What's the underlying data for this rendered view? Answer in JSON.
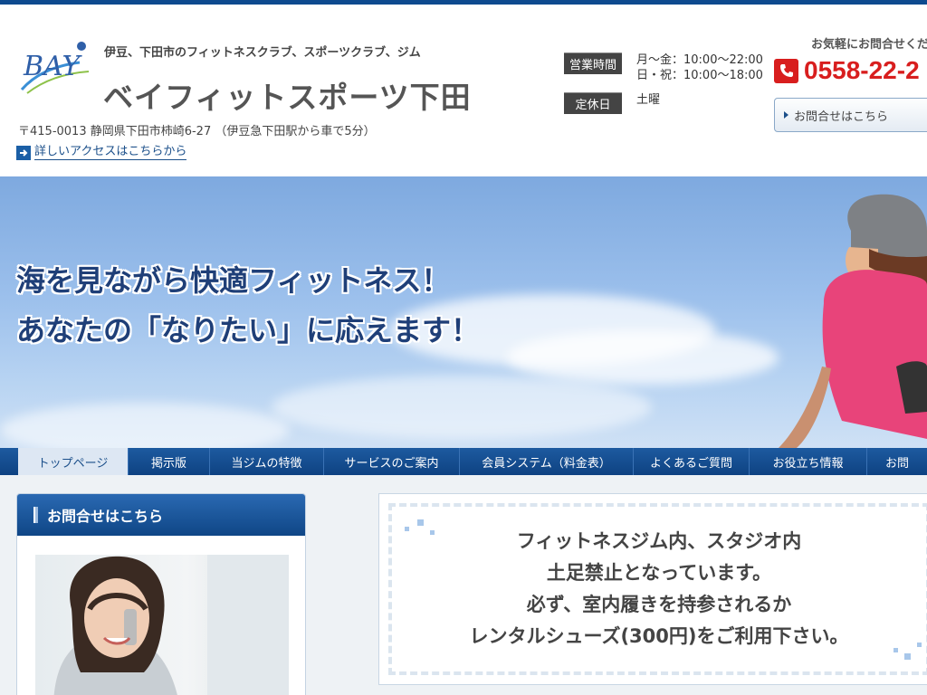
{
  "header": {
    "tagline": "伊豆、下田市のフィットネスクラブ、スポーツクラブ、ジム",
    "site_title": "ベイフィットスポーツ下田",
    "logo_text": "BAY",
    "address": "〒415-0013 静岡県下田市柿崎6-27 （伊豆急下田駅から車で5分）",
    "access_link": "詳しいアクセスはこちらから",
    "hours_label": "営業時間",
    "hours_weekday": "月～金：10:00～22:00",
    "hours_weekend": "日・祝：10:00～18:00",
    "closed_label": "定休日",
    "closed_day": "土曜",
    "contact_note": "お気軽にお問合せくだ",
    "phone": "0558-22-2",
    "contact_button": "お問合せはこちら"
  },
  "hero": {
    "line1": "海を見ながら快適フィットネス！",
    "line2": "あなたの「なりたい」に応えます！"
  },
  "nav": {
    "items": [
      {
        "label": "トップページ",
        "active": true
      },
      {
        "label": "掲示版",
        "active": false
      },
      {
        "label": "当ジムの特徴",
        "active": false
      },
      {
        "label": "サービスのご案内",
        "active": false
      },
      {
        "label": "会員システム（料金表）",
        "active": false
      },
      {
        "label": "よくあるご質問",
        "active": false
      },
      {
        "label": "お役立ち情報",
        "active": false
      },
      {
        "label": "お問",
        "active": false
      }
    ]
  },
  "sidebar": {
    "title": "お問合せはこちら"
  },
  "notice": {
    "lines": [
      "フィットネスジム内、スタジオ内",
      "土足禁止となっています。",
      "必ず、室内履きを持参されるか",
      "レンタルシューズ(300円)をご利用下さい。"
    ]
  },
  "colors": {
    "brand_blue": "#0e4a8f",
    "phone_red": "#d81e1e",
    "hero_text": "#1f3f78"
  }
}
